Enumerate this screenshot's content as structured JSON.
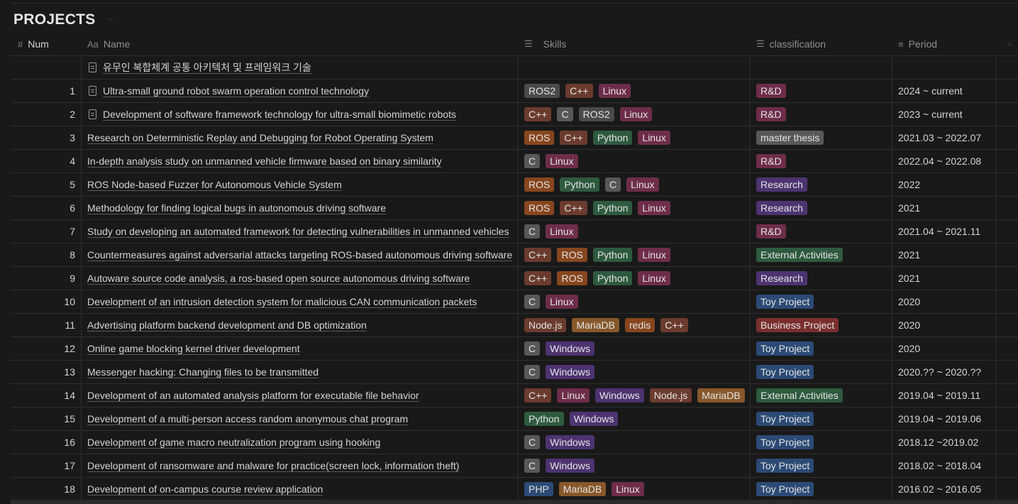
{
  "page": {
    "title": "PROJECTS"
  },
  "colors": {
    "ROS2": "#4a4a4a",
    "C++": "#6b3b2e",
    "Linux": "#6e2d4a",
    "C": "#585858",
    "ROS": "#87461e",
    "Python": "#2e5a3e",
    "Node.js": "#6b3b2e",
    "MariaDB": "#87582a",
    "redis": "#87461e",
    "Windows": "#4d3370",
    "PHP": "#2c4a75",
    "R&D": "#6e2d4a",
    "master thesis": "#585858",
    "Research": "#4d3370",
    "External Activities": "#2e5a3e",
    "Toy Project": "#2c4a75",
    "Business Project": "#7a2e2e"
  },
  "columns": {
    "num": {
      "label": "Num",
      "icon": "hash-icon"
    },
    "name": {
      "label": "Name",
      "icon": "text-icon"
    },
    "skills": {
      "label": "Skills",
      "icon": "list-icon"
    },
    "classification": {
      "label": "classification",
      "icon": "list-icon"
    },
    "period": {
      "label": "Period",
      "icon": "lines-icon"
    }
  },
  "rows": [
    {
      "num": "",
      "name": "유무인 복합체계 공통 아키텍처 및 프레임워크 기술",
      "page": true,
      "skills": [],
      "classification": "",
      "period": ""
    },
    {
      "num": "1",
      "name": "Ultra-small ground robot swarm operation control technology",
      "page": true,
      "skills": [
        "ROS2",
        "C++",
        "Linux"
      ],
      "classification": "R&D",
      "period": "2024 ~ current"
    },
    {
      "num": "2",
      "name": "Development of software framework technology for ultra-small biomimetic robots",
      "page": true,
      "skills": [
        "C++",
        "C",
        "ROS2",
        "Linux"
      ],
      "classification": "R&D",
      "period": "2023 ~ current"
    },
    {
      "num": "3",
      "name": "Research on Deterministic Replay and Debugging for Robot Operating System",
      "page": false,
      "skills": [
        "ROS",
        "C++",
        "Python",
        "Linux"
      ],
      "classification": "master thesis",
      "period": "2021.03 ~ 2022.07"
    },
    {
      "num": "4",
      "name": "In-depth analysis study on unmanned vehicle firmware based on binary similarity",
      "page": false,
      "skills": [
        "C",
        "Linux"
      ],
      "classification": "R&D",
      "period": "2022.04 ~ 2022.08"
    },
    {
      "num": "5",
      "name": "ROS Node-based Fuzzer for Autonomous Vehicle System",
      "page": false,
      "skills": [
        "ROS",
        "Python",
        "C",
        "Linux"
      ],
      "classification": "Research",
      "period": "2022"
    },
    {
      "num": "6",
      "name": "Methodology for finding logical bugs in autonomous driving software",
      "page": false,
      "skills": [
        "ROS",
        "C++",
        "Python",
        "Linux"
      ],
      "classification": "Research",
      "period": "2021"
    },
    {
      "num": "7",
      "name": "Study on developing an automated framework for detecting vulnerabilities in unmanned vehicles",
      "page": false,
      "skills": [
        "C",
        "Linux"
      ],
      "classification": "R&D",
      "period": "2021.04 ~ 2021.11"
    },
    {
      "num": "8",
      "name": "Countermeasures against adversarial attacks targeting ROS-based autonomous driving software",
      "page": false,
      "skills": [
        "C++",
        "ROS",
        "Python",
        "Linux"
      ],
      "classification": "External Activities",
      "period": "2021"
    },
    {
      "num": "9",
      "name": "Autoware source code analysis, a ros-based open source autonomous driving software",
      "page": false,
      "skills": [
        "C++",
        "ROS",
        "Python",
        "Linux"
      ],
      "classification": "Research",
      "period": "2021"
    },
    {
      "num": "10",
      "name": "Development of an intrusion detection system for malicious CAN communication packets",
      "page": false,
      "skills": [
        "C",
        "Linux"
      ],
      "classification": "Toy Project",
      "period": "2020"
    },
    {
      "num": "11",
      "name": "Advertising platform backend development and DB optimization",
      "page": false,
      "skills": [
        "Node.js",
        "MariaDB",
        "redis",
        "C++"
      ],
      "classification": "Business Project",
      "period": "2020"
    },
    {
      "num": "12",
      "name": "Online game blocking kernel driver development",
      "page": false,
      "skills": [
        "C",
        "Windows"
      ],
      "classification": "Toy Project",
      "period": "2020"
    },
    {
      "num": "13",
      "name": "Messenger hacking: Changing files to be transmitted",
      "page": false,
      "skills": [
        "C",
        "Windows"
      ],
      "classification": "Toy Project",
      "period": "2020.?? ~ 2020.??"
    },
    {
      "num": "14",
      "name": "Development of an automated analysis platform for executable file behavior",
      "page": false,
      "skills": [
        "C++",
        "Linux",
        "Windows",
        "Node.js",
        "MariaDB"
      ],
      "classification": "External Activities",
      "period": "2019.04 ~ 2019.11"
    },
    {
      "num": "15",
      "name": "Development of a multi-person access random anonymous chat program",
      "page": false,
      "skills": [
        "Python",
        "Windows"
      ],
      "classification": "Toy Project",
      "period": "2019.04 ~ 2019.06"
    },
    {
      "num": "16",
      "name": "Development of game macro neutralization program using hooking",
      "page": false,
      "skills": [
        "C",
        "Windows"
      ],
      "classification": "Toy Project",
      "period": "2018.12 ~2019.02"
    },
    {
      "num": "17",
      "name": "Development of ransomware and malware for practice(screen lock, information theft)",
      "page": false,
      "skills": [
        "C",
        "Windows"
      ],
      "classification": "Toy Project",
      "period": "2018.02 ~ 2018.04"
    },
    {
      "num": "18",
      "name": "Development of on-campus course review application",
      "page": false,
      "skills": [
        "PHP",
        "MariaDB",
        "Linux"
      ],
      "classification": "Toy Project",
      "period": "2016.02 ~ 2016.05"
    }
  ]
}
